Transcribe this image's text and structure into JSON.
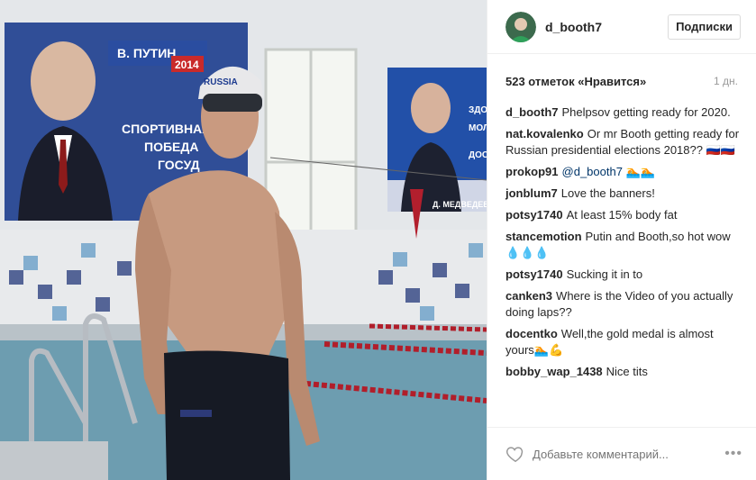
{
  "header": {
    "username": "d_booth7",
    "follow_label": "Подписки"
  },
  "post": {
    "likes_text": "523 отметок «Нравится»",
    "age": "1 дн.",
    "photo_banners": {
      "left_name": "В. ПУТИН",
      "left_year": "2014",
      "left_line1": "СПОРТИВНАЯ",
      "left_line2": "ПОБЕДА",
      "left_line3": "ГОСУД",
      "right_text1": "ЗДО",
      "right_text2": "МОЛ",
      "right_text3": "ДОСТ",
      "right_name": "Д. МЕДВЕДЕВ",
      "cap_text": "RUSSIA"
    }
  },
  "comments": [
    {
      "user": "d_booth7",
      "text": "Phelpsov getting ready for 2020."
    },
    {
      "user": "nat.kovalenko",
      "text": "Or mr Booth getting ready for Russian presidential elections 2018?? 🇷🇺🇷🇺"
    },
    {
      "user": "prokop91",
      "mention": "@d_booth7",
      "text": " 🏊🏊"
    },
    {
      "user": "jonblum7",
      "text": "Love the banners!"
    },
    {
      "user": "potsy1740",
      "text": "At least 15% body fat"
    },
    {
      "user": "stancemotion",
      "text": "Putin and Booth,so hot wow 💧💧💧"
    },
    {
      "user": "potsy1740",
      "text": "Sucking it in to"
    },
    {
      "user": "canken3",
      "text": "Where is the Video of you actually doing laps??"
    },
    {
      "user": "docentko",
      "text": "Well,the gold medal is almost yours🏊💪"
    },
    {
      "user": "bobby_wap_1438",
      "text": "Nice tits"
    }
  ],
  "footer": {
    "comment_placeholder": "Добавьте комментарий...",
    "more_label": "•••"
  }
}
